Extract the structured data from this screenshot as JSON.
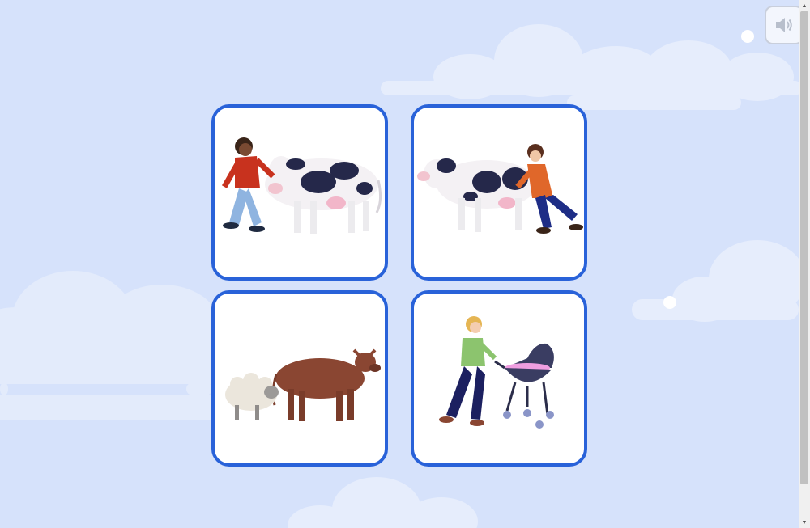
{
  "toolbar": {
    "sound_icon": "speaker-icon"
  },
  "cards": [
    {
      "name": "card-child-pushing-cow",
      "icon": "child-pushing-cow-illustration"
    },
    {
      "name": "card-child-pulling-cow",
      "icon": "child-pulling-cow-illustration"
    },
    {
      "name": "card-sheep-and-calf",
      "icon": "sheep-and-calf-illustration"
    },
    {
      "name": "card-parent-pushing-stroller",
      "icon": "parent-pushing-stroller-illustration"
    }
  ],
  "scrollbar": {
    "up_arrow": "▲",
    "down_arrow": "▼"
  }
}
